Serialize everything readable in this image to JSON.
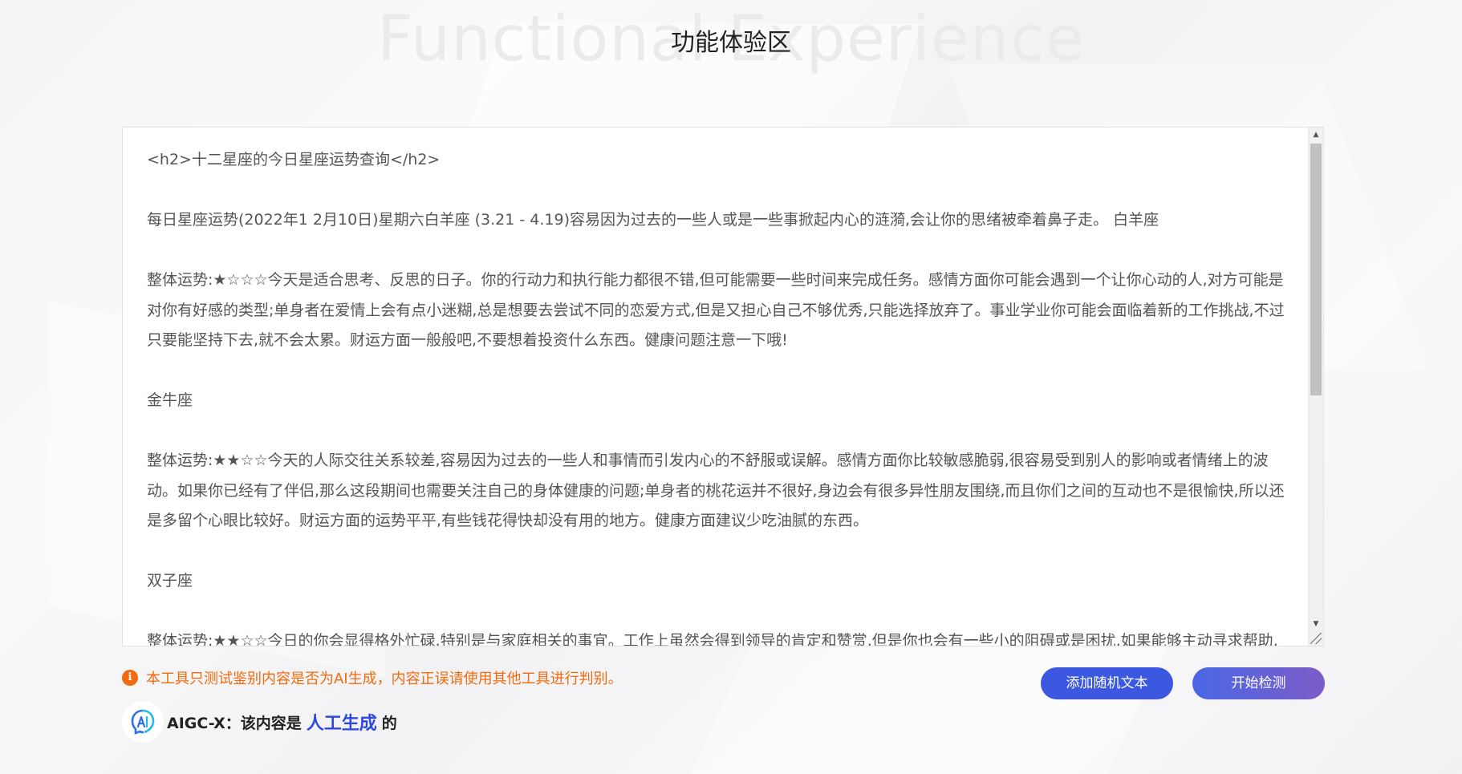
{
  "header": {
    "watermark": "Functional Experience",
    "title": "功能体验区"
  },
  "editor": {
    "paragraphs": [
      "<h2>十二星座的今日星座运势查询</h2>",
      "每日星座运势(2022年1 2月10日)星期六白羊座 (3.21 - 4.19)容易因为过去的一些人或是一些事掀起内心的涟漪,会让你的思绪被牵着鼻子走。 白羊座",
      "整体运势:★☆☆☆今天是适合思考、反思的日子。你的行动力和执行能力都很不错,但可能需要一些时间来完成任务。感情方面你可能会遇到一个让你心动的人,对方可能是对你有好感的类型;单身者在爱情上会有点小迷糊,总是想要去尝试不同的恋爱方式,但是又担心自己不够优秀,只能选择放弃了。事业学业你可能会面临着新的工作挑战,不过只要能坚持下去,就不会太累。财运方面一般般吧,不要想着投资什么东西。健康问题注意一下哦!",
      "金牛座",
      "整体运势:★★☆☆今天的人际交往关系较差,容易因为过去的一些人和事情而引发内心的不舒服或误解。感情方面你比较敏感脆弱,很容易受到别人的影响或者情绪上的波动。如果你已经有了伴侣,那么这段期间也需要关注自己的身体健康的问题;单身者的桃花运并不很好,身边会有很多异性朋友围绕,而且你们之间的互动也不是很愉快,所以还是多留个心眼比较好。财运方面的运势平平,有些钱花得快却没有用的地方。健康方面建议少吃油腻的东西。",
      "双子座",
      "整体运势:★★☆☆今日的你会显得格外忙碌,特别是与家庭相关的事宜。工作上虽然会得到领导的肯定和赞赏,但是你也会有一些小的阻碍或是困扰,如果能够主动寻求帮助,会有所改善。"
    ]
  },
  "notice": {
    "text": "本工具只测试鉴别内容是否为AI生成，内容正误请使用其他工具进行判别。"
  },
  "buttons": {
    "random_label": "添加随机文本",
    "start_label": "开始检测"
  },
  "result": {
    "label": "AIGC-X：该内容是",
    "value": "人工生成",
    "suffix": "的"
  },
  "colors": {
    "accent": "#3d58e0",
    "warning": "#f26b0f",
    "result": "#2f49e0"
  }
}
